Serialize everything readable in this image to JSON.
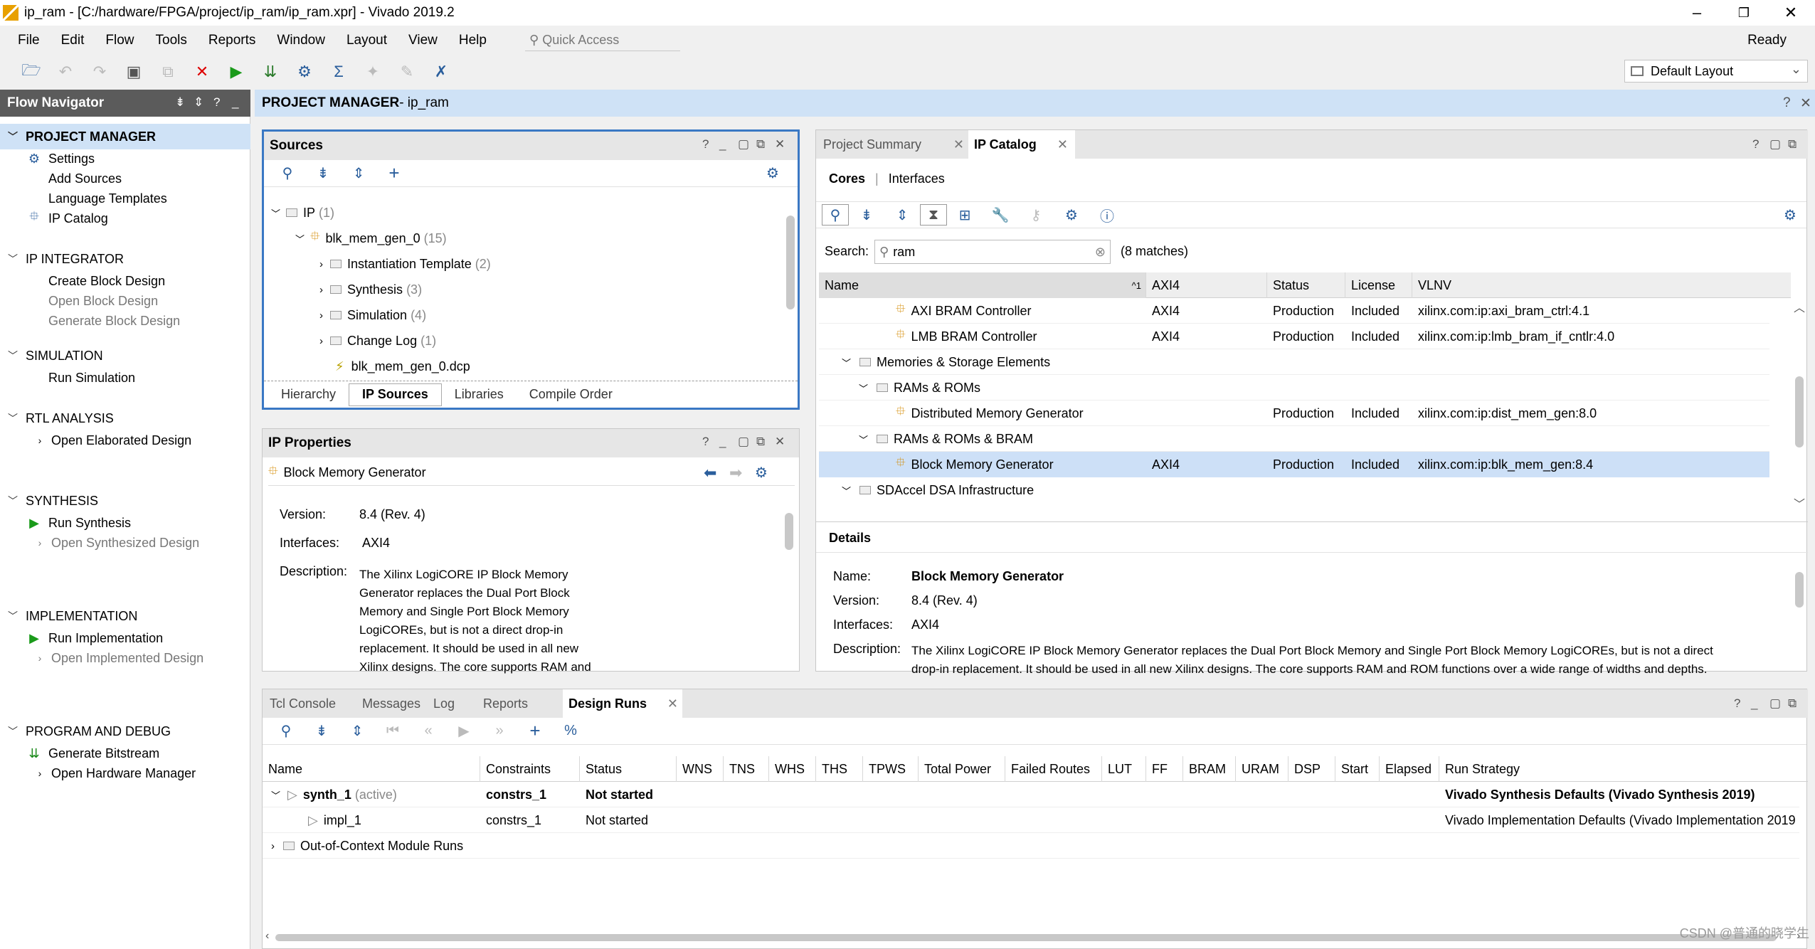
{
  "window": {
    "title": "ip_ram - [C:/hardware/FPGA/project/ip_ram/ip_ram.xpr] - Vivado 2019.2"
  },
  "menu": [
    "File",
    "Edit",
    "Flow",
    "Tools",
    "Reports",
    "Window",
    "Layout",
    "View",
    "Help"
  ],
  "quick_access": {
    "placeholder": "Quick Access"
  },
  "status": "Ready",
  "layout_select": "Default Layout",
  "flow_navigator": {
    "title": "Flow Navigator",
    "sections": [
      {
        "label": "PROJECT MANAGER",
        "items": [
          "Settings",
          "Add Sources",
          "Language Templates",
          "IP Catalog"
        ]
      },
      {
        "label": "IP INTEGRATOR",
        "items": [
          "Create Block Design",
          "Open Block Design",
          "Generate Block Design"
        ]
      },
      {
        "label": "SIMULATION",
        "items": [
          "Run Simulation"
        ]
      },
      {
        "label": "RTL ANALYSIS",
        "items": [
          "Open Elaborated Design"
        ]
      },
      {
        "label": "SYNTHESIS",
        "items": [
          "Run Synthesis",
          "Open Synthesized Design"
        ]
      },
      {
        "label": "IMPLEMENTATION",
        "items": [
          "Run Implementation",
          "Open Implemented Design"
        ]
      },
      {
        "label": "PROGRAM AND DEBUG",
        "items": [
          "Generate Bitstream",
          "Open Hardware Manager"
        ]
      }
    ]
  },
  "pm_header": {
    "bold": "PROJECT MANAGER",
    "rest": " - ip_ram"
  },
  "sources": {
    "title": "Sources",
    "tree": [
      {
        "label": "IP",
        "count": "(1)"
      },
      {
        "label": "blk_mem_gen_0",
        "count": "(15)"
      },
      {
        "label": "Instantiation Template",
        "count": "(2)"
      },
      {
        "label": "Synthesis",
        "count": "(3)"
      },
      {
        "label": "Simulation",
        "count": "(4)"
      },
      {
        "label": "Change Log",
        "count": "(1)"
      },
      {
        "label": "blk_mem_gen_0.dcp",
        "count": ""
      }
    ],
    "tabs": [
      "Hierarchy",
      "IP Sources",
      "Libraries",
      "Compile Order"
    ]
  },
  "ip_properties": {
    "title": "IP Properties",
    "name": "Block Memory Generator",
    "version_label": "Version:",
    "version": "8.4 (Rev. 4)",
    "interfaces_label": "Interfaces:",
    "interfaces": "AXI4",
    "description_label": "Description:",
    "description_lines": [
      "The Xilinx LogiCORE IP Block Memory",
      "Generator replaces the Dual Port Block",
      "Memory and Single Port Block Memory",
      "LogiCOREs, but is not a direct drop-in",
      "replacement. It should be used in all new",
      "Xilinx designs. The core supports RAM and"
    ]
  },
  "ip_catalog": {
    "tabs": [
      "Project Summary",
      "IP Catalog"
    ],
    "subtabs": [
      "Cores",
      "Interfaces"
    ],
    "search_label": "Search:",
    "search_value": "ram",
    "matches": "(8 matches)",
    "columns": [
      "Name",
      "AXI4",
      "Status",
      "License",
      "VLNV"
    ],
    "sort_mark": "^1",
    "rows": [
      {
        "name": "AXI BRAM Controller",
        "axi": "AXI4",
        "status": "Production",
        "license": "Included",
        "vlnv": "xilinx.com:ip:axi_bram_ctrl:4.1"
      },
      {
        "name": "LMB BRAM Controller",
        "axi": "AXI4",
        "status": "Production",
        "license": "Included",
        "vlnv": "xilinx.com:ip:lmb_bram_if_cntlr:4.0"
      },
      {
        "name": "Memories & Storage Elements",
        "axi": "",
        "status": "",
        "license": "",
        "vlnv": ""
      },
      {
        "name": "RAMs & ROMs",
        "axi": "",
        "status": "",
        "license": "",
        "vlnv": ""
      },
      {
        "name": "Distributed Memory Generator",
        "axi": "",
        "status": "Production",
        "license": "Included",
        "vlnv": "xilinx.com:ip:dist_mem_gen:8.0"
      },
      {
        "name": "RAMs & ROMs & BRAM",
        "axi": "",
        "status": "",
        "license": "",
        "vlnv": ""
      },
      {
        "name": "Block Memory Generator",
        "axi": "AXI4",
        "status": "Production",
        "license": "Included",
        "vlnv": "xilinx.com:ip:blk_mem_gen:8.4"
      },
      {
        "name": "SDAccel DSA Infrastructure",
        "axi": "",
        "status": "",
        "license": "",
        "vlnv": ""
      }
    ],
    "details": {
      "title": "Details",
      "name_label": "Name:",
      "name": "Block Memory Generator",
      "version_label": "Version:",
      "version": "8.4 (Rev. 4)",
      "interfaces_label": "Interfaces:",
      "interfaces": "AXI4",
      "description_label": "Description:",
      "description_1": "The Xilinx LogiCORE IP Block Memory Generator replaces the Dual Port Block Memory and Single Port Block Memory LogiCOREs, but is not a direct",
      "description_2": "drop-in replacement.  It should be used in all new Xilinx designs. The core supports RAM and ROM functions over a wide range of widths and depths."
    }
  },
  "bottom": {
    "tabs": [
      "Tcl Console",
      "Messages",
      "Log",
      "Reports",
      "Design Runs"
    ],
    "columns": [
      "Name",
      "Constraints",
      "Status",
      "WNS",
      "TNS",
      "WHS",
      "THS",
      "TPWS",
      "Total Power",
      "Failed Routes",
      "LUT",
      "FF",
      "BRAM",
      "URAM",
      "DSP",
      "Start",
      "Elapsed",
      "Run Strategy"
    ],
    "runs": [
      {
        "name": "synth_1",
        "suffix": "(active)",
        "constraints": "constrs_1",
        "status": "Not started",
        "strategy": "Vivado Synthesis Defaults (Vivado Synthesis 2019)"
      },
      {
        "name": "impl_1",
        "suffix": "",
        "constraints": "constrs_1",
        "status": "Not started",
        "strategy": "Vivado Implementation Defaults (Vivado Implementation 2019"
      },
      {
        "name": "Out-of-Context Module Runs",
        "suffix": "",
        "constraints": "",
        "status": "",
        "strategy": ""
      }
    ]
  },
  "watermark": "CSDN @普通的晓学生"
}
